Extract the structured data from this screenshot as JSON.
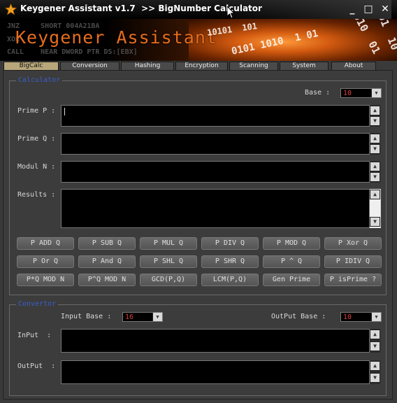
{
  "window": {
    "title": "Keygener Assistant v1.7  >> BigNumber Calculator",
    "controls": {
      "minimize": "_",
      "maximize": "□",
      "close": "✕"
    }
  },
  "banner": {
    "title": "Keygener Assistant",
    "asm_lines": [
      "JNZ     SHORT 004A21BA",
      "XOR",
      "CALL    NEAR DWORD PTR DS:[EBX]"
    ],
    "binary_lines": [
      "10101  101",
      "0101 1010  1 01",
      "1 010  01",
      "0101  10  01"
    ]
  },
  "tabs": [
    {
      "label": "BigCalc",
      "active": true
    },
    {
      "label": "Conversion",
      "active": false
    },
    {
      "label": "Hashing",
      "active": false
    },
    {
      "label": "Encryption",
      "active": false
    },
    {
      "label": "Scanning",
      "active": false
    },
    {
      "label": "System",
      "active": false
    },
    {
      "label": "About",
      "active": false
    }
  ],
  "calculator": {
    "group_title": "Calculator",
    "base_label": "Base :",
    "base_value": "10",
    "fields": [
      {
        "label": "Prime P :",
        "value": ""
      },
      {
        "label": "Prime Q :",
        "value": ""
      },
      {
        "label": "Modul N :",
        "value": ""
      },
      {
        "label": "Results :",
        "value": ""
      }
    ],
    "buttons": [
      [
        "P ADD Q",
        "P SUB Q",
        "P MUL Q",
        "P DIV Q",
        "P MOD Q",
        "P Xor Q"
      ],
      [
        "P Or Q",
        "P And Q",
        "P SHL Q",
        "P SHR Q",
        "P ^ Q",
        "P IDIV Q"
      ],
      [
        "P*Q MOD N",
        "P^Q MOD N",
        "GCD(P,Q)",
        "LCM(P,Q)",
        "Gen Prime",
        "P isPrime ?"
      ]
    ]
  },
  "convertor": {
    "group_title": "Convertor",
    "input_base_label": "Input Base :",
    "input_base_value": "16",
    "output_base_label": "OutPut Base :",
    "output_base_value": "10",
    "input_label": "InPut  :",
    "output_label": "OutPut  :",
    "input_value": "",
    "output_value": ""
  },
  "colors": {
    "accent_orange": "#e86d1c",
    "group_title_blue": "#3a5ecb",
    "combo_value_red": "#e03c3c",
    "active_tab": "#b8a77a"
  },
  "icons": {
    "app": "star-icon",
    "cursor": "mouse-pointer-icon",
    "spin_up": "chevron-up-icon",
    "spin_down": "chevron-down-icon",
    "dropdown": "triangle-down-icon"
  }
}
